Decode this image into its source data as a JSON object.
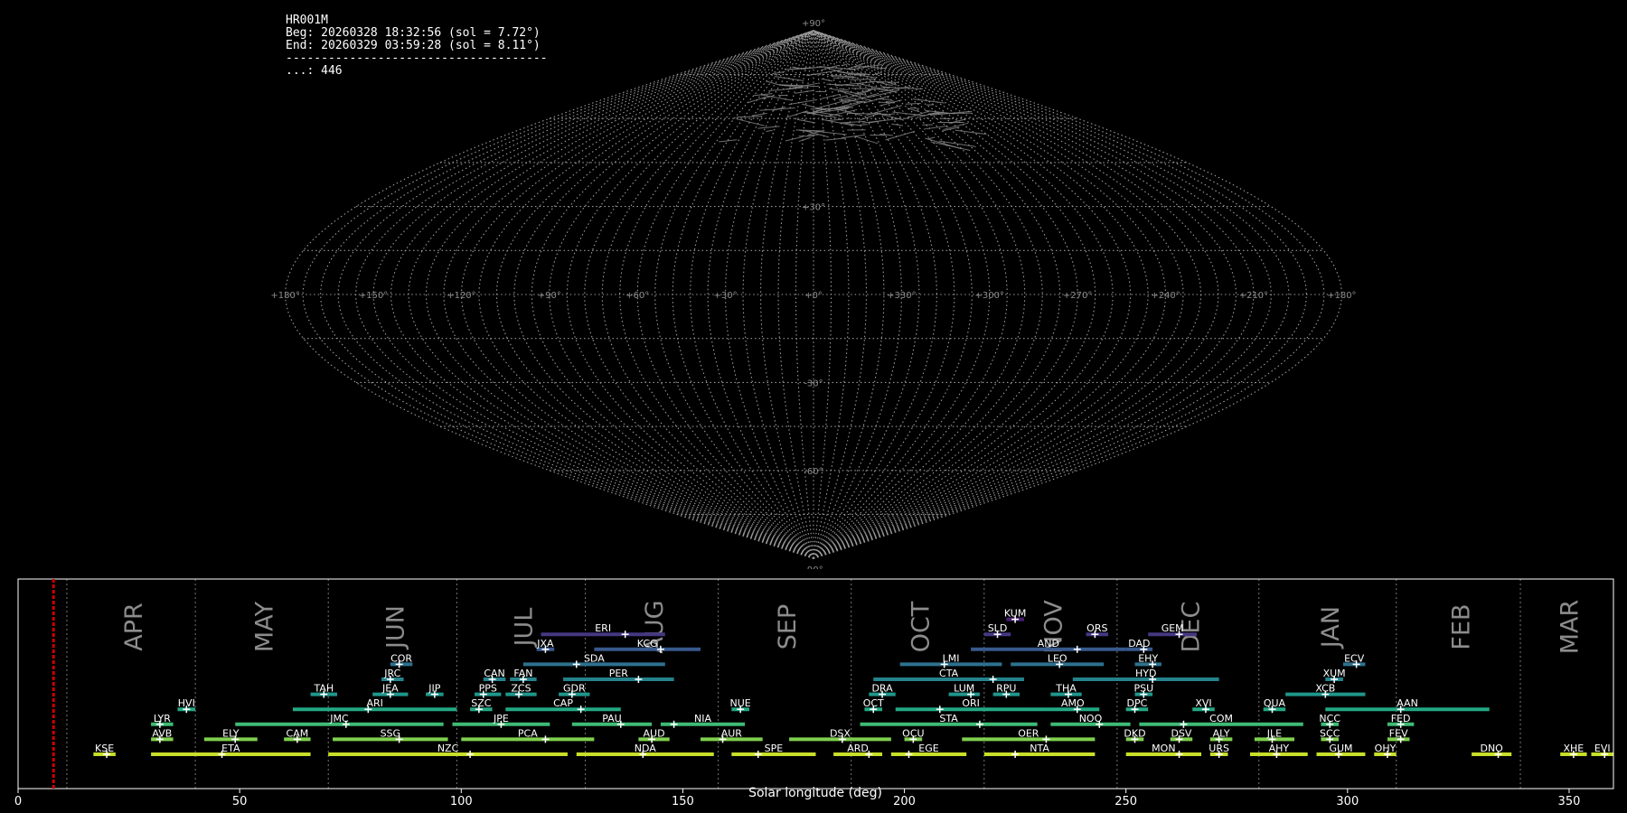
{
  "info": {
    "station": "HR001M",
    "begin": "Beg: 20260328 18:32:56 (sol = 7.72°)",
    "end": "End: 20260329 03:59:28 (sol = 8.11°)",
    "separator": "-------------------------------------",
    "count_line": "...: 446"
  },
  "sky_map": {
    "projection": "sinusoidal",
    "lat_labels": [
      "+90°",
      "+30°",
      "-30°",
      "-60°",
      "-90°"
    ],
    "lon_labels": [
      "+180°",
      "+150°",
      "+120°",
      "+90°",
      "+60°",
      "+30°",
      "+0°",
      "+330°",
      "+300°",
      "+270°",
      "+240°",
      "+210°",
      "+180°"
    ]
  },
  "chart_data": {
    "type": "timeline",
    "xlabel": "Solar longitude (deg)",
    "xlim": [
      0,
      360
    ],
    "xticks": [
      0,
      50,
      100,
      150,
      200,
      250,
      300,
      350
    ],
    "current_sol": 8.0,
    "current_color": "#cc0000",
    "months": [
      {
        "label": "APR",
        "start": 11
      },
      {
        "label": "MAY",
        "start": 40
      },
      {
        "label": "JUN",
        "start": 70
      },
      {
        "label": "JUL",
        "start": 99
      },
      {
        "label": "AUG",
        "start": 128
      },
      {
        "label": "SEP",
        "start": 158
      },
      {
        "label": "OCT",
        "start": 188
      },
      {
        "label": "NOV",
        "start": 218
      },
      {
        "label": "DEC",
        "start": 248
      },
      {
        "label": "JAN",
        "start": 280
      },
      {
        "label": "FEB",
        "start": 311
      },
      {
        "label": "MAR",
        "start": 339
      }
    ],
    "showers": [
      {
        "code": "KUM",
        "start": 223,
        "end": 227,
        "peak": 225,
        "row": 9
      },
      {
        "code": "ERI",
        "start": 118,
        "end": 146,
        "peak": 137,
        "row": 8
      },
      {
        "code": "SLD",
        "start": 218,
        "end": 224,
        "peak": 221,
        "row": 8
      },
      {
        "code": "ORS",
        "start": 241,
        "end": 246,
        "peak": 243,
        "row": 8
      },
      {
        "code": "GEM",
        "start": 255,
        "end": 266,
        "peak": 262,
        "row": 8
      },
      {
        "code": "JXA",
        "start": 117,
        "end": 121,
        "peak": 119,
        "row": 7
      },
      {
        "code": "KCG",
        "start": 130,
        "end": 154,
        "peak": 145,
        "row": 7
      },
      {
        "code": "AND",
        "start": 215,
        "end": 250,
        "peak": 239,
        "row": 7
      },
      {
        "code": "DAD",
        "start": 250,
        "end": 256,
        "peak": 254,
        "row": 7
      },
      {
        "code": "COR",
        "start": 84,
        "end": 89,
        "peak": 86,
        "row": 6
      },
      {
        "code": "SDA",
        "start": 114,
        "end": 146,
        "peak": 126,
        "row": 6
      },
      {
        "code": "LMI",
        "start": 199,
        "end": 222,
        "peak": 209,
        "row": 6
      },
      {
        "code": "LEO",
        "start": 224,
        "end": 245,
        "peak": 235,
        "row": 6
      },
      {
        "code": "EHY",
        "start": 252,
        "end": 258,
        "peak": 256,
        "row": 6
      },
      {
        "code": "ECV",
        "start": 299,
        "end": 304,
        "peak": 302,
        "row": 6
      },
      {
        "code": "JRC",
        "start": 82,
        "end": 87,
        "peak": 84,
        "row": 5
      },
      {
        "code": "CAN",
        "start": 105,
        "end": 110,
        "peak": 107,
        "row": 5
      },
      {
        "code": "FAN",
        "start": 111,
        "end": 117,
        "peak": 114,
        "row": 5
      },
      {
        "code": "PER",
        "start": 123,
        "end": 148,
        "peak": 140,
        "row": 5
      },
      {
        "code": "CTA",
        "start": 193,
        "end": 227,
        "peak": 220,
        "row": 5
      },
      {
        "code": "HYD",
        "start": 238,
        "end": 271,
        "peak": 256,
        "row": 5
      },
      {
        "code": "XUM",
        "start": 295,
        "end": 299,
        "peak": 297,
        "row": 5
      },
      {
        "code": "TAH",
        "start": 66,
        "end": 72,
        "peak": 69,
        "row": 4
      },
      {
        "code": "JEA",
        "start": 80,
        "end": 88,
        "peak": 84,
        "row": 4
      },
      {
        "code": "JIP",
        "start": 92,
        "end": 96,
        "peak": 94,
        "row": 4
      },
      {
        "code": "PPS",
        "start": 103,
        "end": 109,
        "peak": 105,
        "row": 4
      },
      {
        "code": "ZCS",
        "start": 110,
        "end": 117,
        "peak": 113,
        "row": 4
      },
      {
        "code": "GDR",
        "start": 122,
        "end": 129,
        "peak": 125,
        "row": 4
      },
      {
        "code": "DRA",
        "start": 192,
        "end": 198,
        "peak": 195,
        "row": 4
      },
      {
        "code": "LUM",
        "start": 210,
        "end": 217,
        "peak": 215,
        "row": 4
      },
      {
        "code": "RPU",
        "start": 220,
        "end": 226,
        "peak": 223,
        "row": 4
      },
      {
        "code": "THA",
        "start": 233,
        "end": 240,
        "peak": 237,
        "row": 4
      },
      {
        "code": "PSU",
        "start": 252,
        "end": 256,
        "peak": 254,
        "row": 4
      },
      {
        "code": "XCB",
        "start": 286,
        "end": 304,
        "peak": 295,
        "row": 4
      },
      {
        "code": "HVI",
        "start": 36,
        "end": 40,
        "peak": 38,
        "row": 3
      },
      {
        "code": "ARI",
        "start": 62,
        "end": 99,
        "peak": 79,
        "row": 3
      },
      {
        "code": "SZC",
        "start": 102,
        "end": 107,
        "peak": 104,
        "row": 3
      },
      {
        "code": "CAP",
        "start": 110,
        "end": 136,
        "peak": 127,
        "row": 3
      },
      {
        "code": "NUE",
        "start": 161,
        "end": 165,
        "peak": 163,
        "row": 3
      },
      {
        "code": "OCT",
        "start": 191,
        "end": 195,
        "peak": 193,
        "row": 3
      },
      {
        "code": "ORI",
        "start": 198,
        "end": 232,
        "peak": 208,
        "row": 3
      },
      {
        "code": "AMO",
        "start": 232,
        "end": 244,
        "peak": 239,
        "row": 3
      },
      {
        "code": "DPC",
        "start": 250,
        "end": 255,
        "peak": 252,
        "row": 3
      },
      {
        "code": "XVI",
        "start": 265,
        "end": 270,
        "peak": 268,
        "row": 3
      },
      {
        "code": "QUA",
        "start": 281,
        "end": 286,
        "peak": 283,
        "row": 3
      },
      {
        "code": "AAN",
        "start": 295,
        "end": 332,
        "peak": 312,
        "row": 3
      },
      {
        "code": "LYR",
        "start": 30,
        "end": 35,
        "peak": 32,
        "row": 2
      },
      {
        "code": "JMC",
        "start": 49,
        "end": 96,
        "peak": 74,
        "row": 2
      },
      {
        "code": "JPE",
        "start": 98,
        "end": 120,
        "peak": 109,
        "row": 2
      },
      {
        "code": "PAU",
        "start": 125,
        "end": 143,
        "peak": 136,
        "row": 2
      },
      {
        "code": "NIA",
        "start": 145,
        "end": 164,
        "peak": 148,
        "row": 2
      },
      {
        "code": "STA",
        "start": 190,
        "end": 230,
        "peak": 217,
        "row": 2
      },
      {
        "code": "NOO",
        "start": 233,
        "end": 251,
        "peak": 244,
        "row": 2
      },
      {
        "code": "COM",
        "start": 253,
        "end": 290,
        "peak": 263,
        "row": 2
      },
      {
        "code": "NCC",
        "start": 294,
        "end": 298,
        "peak": 296,
        "row": 2
      },
      {
        "code": "FED",
        "start": 309,
        "end": 315,
        "peak": 312,
        "row": 2
      },
      {
        "code": "AVB",
        "start": 30,
        "end": 35,
        "peak": 32,
        "row": 1
      },
      {
        "code": "ELY",
        "start": 42,
        "end": 54,
        "peak": 49,
        "row": 1
      },
      {
        "code": "CAM",
        "start": 60,
        "end": 66,
        "peak": 63,
        "row": 1
      },
      {
        "code": "SSG",
        "start": 71,
        "end": 97,
        "peak": 86,
        "row": 1
      },
      {
        "code": "PCA",
        "start": 100,
        "end": 130,
        "peak": 119,
        "row": 1
      },
      {
        "code": "AUD",
        "start": 140,
        "end": 147,
        "peak": 143,
        "row": 1
      },
      {
        "code": "AUR",
        "start": 154,
        "end": 168,
        "peak": 159,
        "row": 1
      },
      {
        "code": "DSX",
        "start": 174,
        "end": 197,
        "peak": 186,
        "row": 1
      },
      {
        "code": "OCU",
        "start": 200,
        "end": 204,
        "peak": 202,
        "row": 1
      },
      {
        "code": "OER",
        "start": 213,
        "end": 243,
        "peak": 232,
        "row": 1
      },
      {
        "code": "DKD",
        "start": 250,
        "end": 254,
        "peak": 252,
        "row": 1
      },
      {
        "code": "DSV",
        "start": 260,
        "end": 265,
        "peak": 262,
        "row": 1
      },
      {
        "code": "ALY",
        "start": 269,
        "end": 274,
        "peak": 271,
        "row": 1
      },
      {
        "code": "JLE",
        "start": 279,
        "end": 288,
        "peak": 283,
        "row": 1
      },
      {
        "code": "SCC",
        "start": 294,
        "end": 298,
        "peak": 296,
        "row": 1
      },
      {
        "code": "FEV",
        "start": 309,
        "end": 314,
        "peak": 312,
        "row": 1
      },
      {
        "code": "KSE",
        "start": 17,
        "end": 22,
        "peak": 20,
        "row": 0
      },
      {
        "code": "ETA",
        "start": 30,
        "end": 66,
        "peak": 46,
        "row": 0
      },
      {
        "code": "NZC",
        "start": 70,
        "end": 124,
        "peak": 102,
        "row": 0
      },
      {
        "code": "NDA",
        "start": 126,
        "end": 157,
        "peak": 141,
        "row": 0
      },
      {
        "code": "SPE",
        "start": 161,
        "end": 180,
        "peak": 167,
        "row": 0
      },
      {
        "code": "ARD",
        "start": 184,
        "end": 195,
        "peak": 192,
        "row": 0
      },
      {
        "code": "EGE",
        "start": 197,
        "end": 214,
        "peak": 201,
        "row": 0
      },
      {
        "code": "NTA",
        "start": 218,
        "end": 243,
        "peak": 225,
        "row": 0
      },
      {
        "code": "MON",
        "start": 250,
        "end": 267,
        "peak": 262,
        "row": 0
      },
      {
        "code": "URS",
        "start": 269,
        "end": 273,
        "peak": 271,
        "row": 0
      },
      {
        "code": "AHY",
        "start": 278,
        "end": 291,
        "peak": 284,
        "row": 0
      },
      {
        "code": "GUM",
        "start": 293,
        "end": 304,
        "peak": 298,
        "row": 0
      },
      {
        "code": "OHY",
        "start": 306,
        "end": 311,
        "peak": 309,
        "row": 0
      },
      {
        "code": "DNO",
        "start": 328,
        "end": 337,
        "peak": 334,
        "row": 0
      },
      {
        "code": "XHE",
        "start": 348,
        "end": 354,
        "peak": 351,
        "row": 0
      },
      {
        "code": "EVI",
        "start": 355,
        "end": 360,
        "peak": 358,
        "row": 0
      }
    ]
  }
}
